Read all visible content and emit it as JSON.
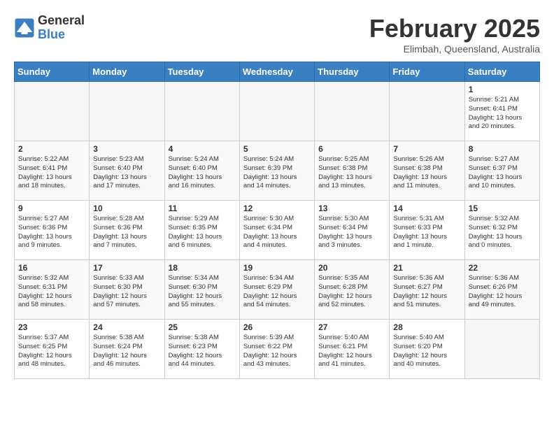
{
  "logo": {
    "general": "General",
    "blue": "Blue"
  },
  "header": {
    "month": "February 2025",
    "location": "Elimbah, Queensland, Australia"
  },
  "days_of_week": [
    "Sunday",
    "Monday",
    "Tuesday",
    "Wednesday",
    "Thursday",
    "Friday",
    "Saturday"
  ],
  "weeks": [
    [
      {
        "day": "",
        "info": ""
      },
      {
        "day": "",
        "info": ""
      },
      {
        "day": "",
        "info": ""
      },
      {
        "day": "",
        "info": ""
      },
      {
        "day": "",
        "info": ""
      },
      {
        "day": "",
        "info": ""
      },
      {
        "day": "1",
        "info": "Sunrise: 5:21 AM\nSunset: 6:41 PM\nDaylight: 13 hours\nand 20 minutes."
      }
    ],
    [
      {
        "day": "2",
        "info": "Sunrise: 5:22 AM\nSunset: 6:41 PM\nDaylight: 13 hours\nand 18 minutes."
      },
      {
        "day": "3",
        "info": "Sunrise: 5:23 AM\nSunset: 6:40 PM\nDaylight: 13 hours\nand 17 minutes."
      },
      {
        "day": "4",
        "info": "Sunrise: 5:24 AM\nSunset: 6:40 PM\nDaylight: 13 hours\nand 16 minutes."
      },
      {
        "day": "5",
        "info": "Sunrise: 5:24 AM\nSunset: 6:39 PM\nDaylight: 13 hours\nand 14 minutes."
      },
      {
        "day": "6",
        "info": "Sunrise: 5:25 AM\nSunset: 6:38 PM\nDaylight: 13 hours\nand 13 minutes."
      },
      {
        "day": "7",
        "info": "Sunrise: 5:26 AM\nSunset: 6:38 PM\nDaylight: 13 hours\nand 11 minutes."
      },
      {
        "day": "8",
        "info": "Sunrise: 5:27 AM\nSunset: 6:37 PM\nDaylight: 13 hours\nand 10 minutes."
      }
    ],
    [
      {
        "day": "9",
        "info": "Sunrise: 5:27 AM\nSunset: 6:36 PM\nDaylight: 13 hours\nand 9 minutes."
      },
      {
        "day": "10",
        "info": "Sunrise: 5:28 AM\nSunset: 6:36 PM\nDaylight: 13 hours\nand 7 minutes."
      },
      {
        "day": "11",
        "info": "Sunrise: 5:29 AM\nSunset: 6:35 PM\nDaylight: 13 hours\nand 6 minutes."
      },
      {
        "day": "12",
        "info": "Sunrise: 5:30 AM\nSunset: 6:34 PM\nDaylight: 13 hours\nand 4 minutes."
      },
      {
        "day": "13",
        "info": "Sunrise: 5:30 AM\nSunset: 6:34 PM\nDaylight: 13 hours\nand 3 minutes."
      },
      {
        "day": "14",
        "info": "Sunrise: 5:31 AM\nSunset: 6:33 PM\nDaylight: 13 hours\nand 1 minute."
      },
      {
        "day": "15",
        "info": "Sunrise: 5:32 AM\nSunset: 6:32 PM\nDaylight: 13 hours\nand 0 minutes."
      }
    ],
    [
      {
        "day": "16",
        "info": "Sunrise: 5:32 AM\nSunset: 6:31 PM\nDaylight: 12 hours\nand 58 minutes."
      },
      {
        "day": "17",
        "info": "Sunrise: 5:33 AM\nSunset: 6:30 PM\nDaylight: 12 hours\nand 57 minutes."
      },
      {
        "day": "18",
        "info": "Sunrise: 5:34 AM\nSunset: 6:30 PM\nDaylight: 12 hours\nand 55 minutes."
      },
      {
        "day": "19",
        "info": "Sunrise: 5:34 AM\nSunset: 6:29 PM\nDaylight: 12 hours\nand 54 minutes."
      },
      {
        "day": "20",
        "info": "Sunrise: 5:35 AM\nSunset: 6:28 PM\nDaylight: 12 hours\nand 52 minutes."
      },
      {
        "day": "21",
        "info": "Sunrise: 5:36 AM\nSunset: 6:27 PM\nDaylight: 12 hours\nand 51 minutes."
      },
      {
        "day": "22",
        "info": "Sunrise: 5:36 AM\nSunset: 6:26 PM\nDaylight: 12 hours\nand 49 minutes."
      }
    ],
    [
      {
        "day": "23",
        "info": "Sunrise: 5:37 AM\nSunset: 6:25 PM\nDaylight: 12 hours\nand 48 minutes."
      },
      {
        "day": "24",
        "info": "Sunrise: 5:38 AM\nSunset: 6:24 PM\nDaylight: 12 hours\nand 46 minutes."
      },
      {
        "day": "25",
        "info": "Sunrise: 5:38 AM\nSunset: 6:23 PM\nDaylight: 12 hours\nand 44 minutes."
      },
      {
        "day": "26",
        "info": "Sunrise: 5:39 AM\nSunset: 6:22 PM\nDaylight: 12 hours\nand 43 minutes."
      },
      {
        "day": "27",
        "info": "Sunrise: 5:40 AM\nSunset: 6:21 PM\nDaylight: 12 hours\nand 41 minutes."
      },
      {
        "day": "28",
        "info": "Sunrise: 5:40 AM\nSunset: 6:20 PM\nDaylight: 12 hours\nand 40 minutes."
      },
      {
        "day": "",
        "info": ""
      }
    ]
  ]
}
